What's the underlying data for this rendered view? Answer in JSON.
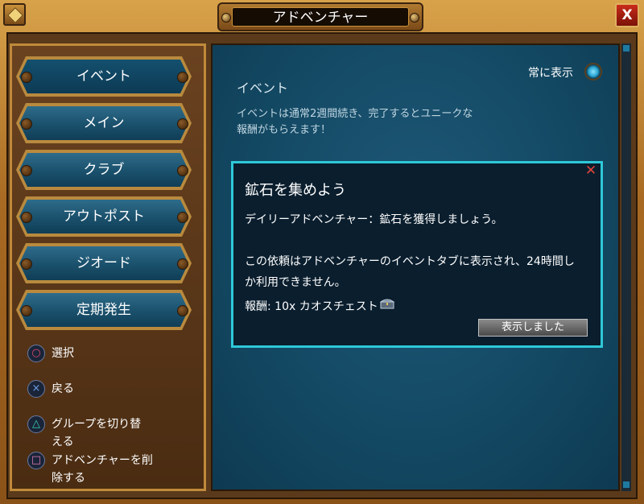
{
  "window": {
    "title": "アドベンチャー",
    "close_label": "X"
  },
  "sidebar": {
    "tabs": [
      {
        "label": "イベント",
        "active": true
      },
      {
        "label": "メイン"
      },
      {
        "label": "クラブ"
      },
      {
        "label": "アウトポスト"
      },
      {
        "label": "ジオード"
      },
      {
        "label": "定期発生"
      }
    ],
    "legend": [
      {
        "icon": "circle-button-icon",
        "label": "選択"
      },
      {
        "icon": "cross-button-icon",
        "label": "戻る"
      },
      {
        "icon": "triangle-button-icon",
        "label": "グループを切り替える"
      },
      {
        "icon": "square-button-icon",
        "label": "アドベンチャーを削除する"
      }
    ],
    "legend_split": {
      "group_line1": "グループを切り替",
      "group_line2": "える",
      "delete_line1": "アドベンチャーを削",
      "delete_line2": "除する"
    }
  },
  "main": {
    "always_show_label": "常に表示",
    "section_title": "イベント",
    "section_desc_line1": "イベントは通常2週間続き、完了するとユニークな",
    "section_desc_line2": "報酬がもらえます！"
  },
  "dialog": {
    "title": "鉱石を集めよう",
    "subtitle": "デイリーアドベンチャー：鉱石を獲得しましょう。",
    "body_line1": "この依頼はアドベンチャーのイベントタブに表示され、24時間し",
    "body_line2": "か利用できません。",
    "reward": "報酬: 10x カオスチェスト",
    "ack_button": "表示しました"
  },
  "colors": {
    "frame_gold": "#c08a3a",
    "panel_teal": "#134862",
    "dialog_border": "#2ec8d8",
    "close_red": "#c92a1a"
  }
}
